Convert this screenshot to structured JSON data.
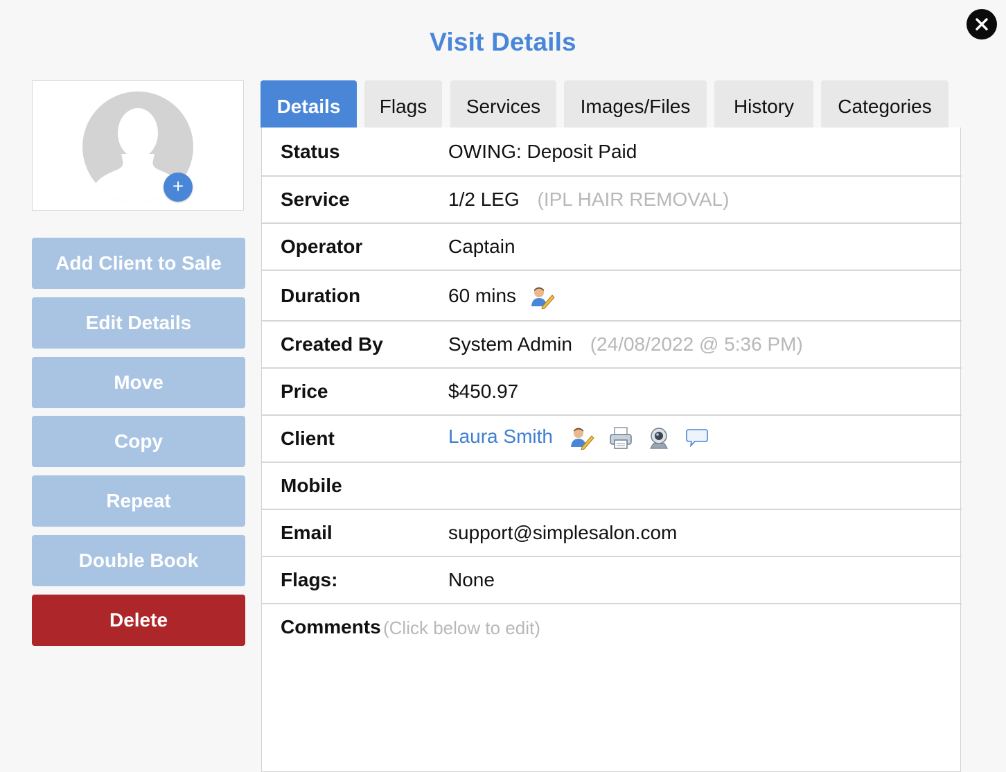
{
  "page": {
    "title": "Visit Details"
  },
  "sidebar": {
    "buttons": {
      "add_client": "Add Client to Sale",
      "edit_details": "Edit Details",
      "move": "Move",
      "copy": "Copy",
      "repeat": "Repeat",
      "double_book": "Double Book",
      "delete": "Delete"
    },
    "add_photo_symbol": "+"
  },
  "tabs": {
    "details": "Details",
    "flags": "Flags",
    "services": "Services",
    "images_files": "Images/Files",
    "history": "History",
    "categories": "Categories"
  },
  "details": {
    "status": {
      "label": "Status",
      "value": "OWING: Deposit Paid"
    },
    "service": {
      "label": "Service",
      "value": "1/2 LEG",
      "category": "(IPL HAIR REMOVAL)"
    },
    "operator": {
      "label": "Operator",
      "value": "Captain"
    },
    "duration": {
      "label": "Duration",
      "value": "60 mins"
    },
    "created_by": {
      "label": "Created By",
      "value": "System Admin",
      "timestamp": "(24/08/2022 @ 5:36 PM)"
    },
    "price": {
      "label": "Price",
      "value": "$450.97"
    },
    "client": {
      "label": "Client",
      "value": "Laura Smith"
    },
    "mobile": {
      "label": "Mobile",
      "value": ""
    },
    "email": {
      "label": "Email",
      "value": "support@simplesalon.com"
    },
    "flags": {
      "label": "Flags:",
      "value": "None"
    },
    "comments": {
      "label": "Comments",
      "hint": "(Click below to edit)"
    }
  },
  "icons": {
    "close": "close-icon",
    "duration_edit": "user-edit-icon",
    "client_edit": "user-edit-icon",
    "client_print": "printer-icon",
    "client_webcam": "webcam-icon",
    "client_message": "speech-bubble-icon"
  },
  "colors": {
    "accent": "#4a86d8",
    "sidebar_button": "#a9c4e3",
    "delete_button": "#ad262a",
    "muted_text": "#b8b8b8"
  }
}
